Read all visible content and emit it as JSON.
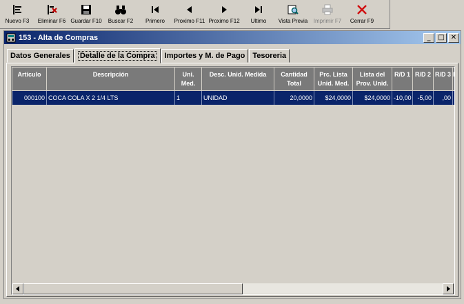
{
  "toolbar": {
    "buttons": [
      {
        "id": "nuevo",
        "label": "Nuevo F3",
        "icon": "new-doc-icon"
      },
      {
        "id": "eliminar",
        "label": "Eliminar F6",
        "icon": "delete-doc-icon"
      },
      {
        "id": "guardar",
        "label": "Guardar F10",
        "icon": "floppy-disk-icon"
      },
      {
        "id": "buscar",
        "label": "Buscar F2",
        "icon": "binoculars-icon"
      },
      {
        "id": "primero",
        "label": "Primero",
        "icon": "first-record-icon"
      },
      {
        "id": "previo",
        "label": "Proximo F11",
        "icon": "prev-record-icon"
      },
      {
        "id": "proximo",
        "label": "Proximo F12",
        "icon": "next-record-icon"
      },
      {
        "id": "ultimo",
        "label": "Ultimo",
        "icon": "last-record-icon"
      },
      {
        "id": "vista",
        "label": "Vista Previa",
        "icon": "print-preview-icon"
      },
      {
        "id": "imprimir",
        "label": "Imprimir F7",
        "icon": "printer-icon",
        "disabled": true
      },
      {
        "id": "cerrar",
        "label": "Cerrar F9",
        "icon": "close-x-icon"
      }
    ]
  },
  "window": {
    "title": "153 - Alta de Compras",
    "minimize": "_",
    "maximize": "□",
    "close": "✕"
  },
  "tabs": [
    {
      "label": "Datos Generales"
    },
    {
      "label": "Detalle de la Compra",
      "active": true
    },
    {
      "label": "Importes y M. de Pago"
    },
    {
      "label": "Tesoreria"
    }
  ],
  "grid": {
    "headers": [
      "Articulo",
      "Descripción",
      "Uni.\nMed.",
      "Desc. Unid. Medida",
      "Cantidad\nTotal",
      "Prc. Lista\nUnid. Med.",
      "Lista del\nProv. Unid.",
      "R/D 1",
      "R/D 2",
      "R/D 3",
      "R"
    ],
    "rows": [
      [
        "000100",
        "COCA COLA X 2 1/4 LTS",
        "1",
        "UNIDAD",
        "20,0000",
        "$24,0000",
        "$24,0000",
        "-10,00",
        "-5,00",
        ",00",
        ""
      ]
    ]
  },
  "colors": {
    "selection": "#0a246a",
    "header_bg": "#7a7a7a",
    "close_red": "#d01010"
  }
}
